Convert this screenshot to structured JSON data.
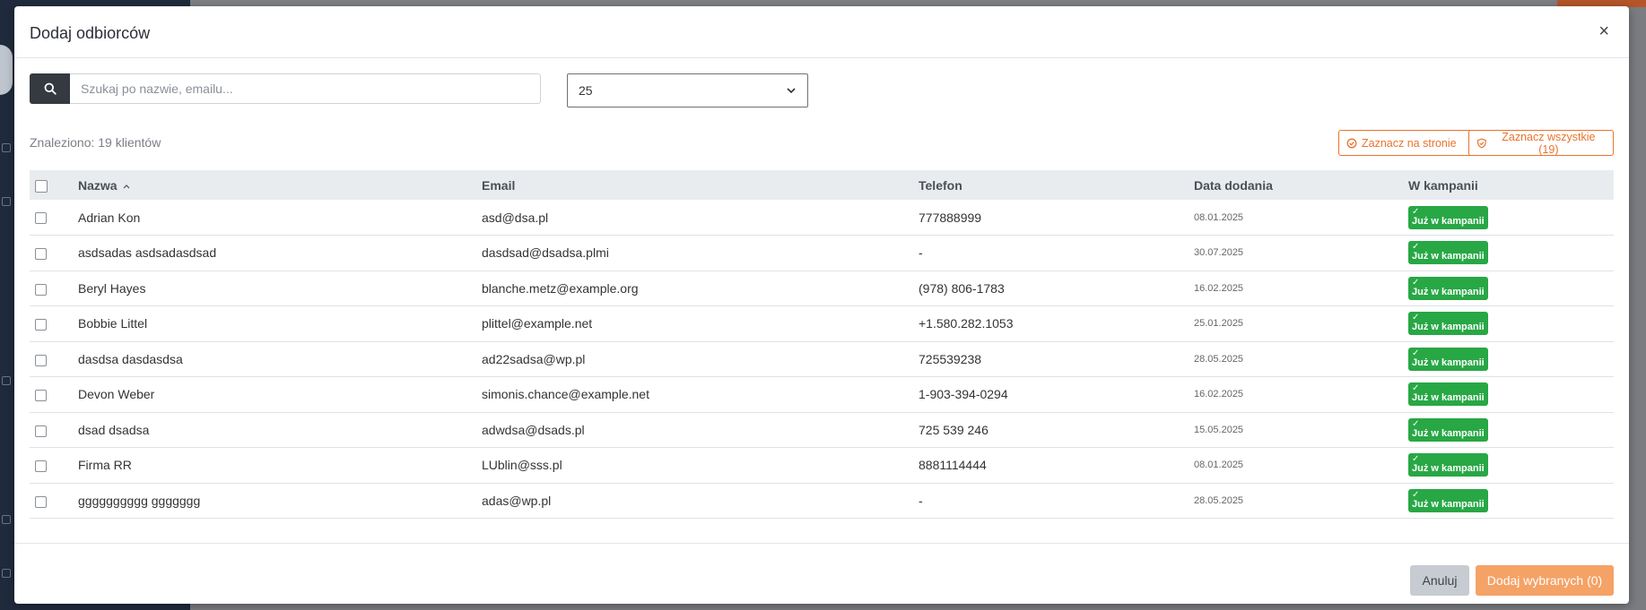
{
  "modal": {
    "title": "Dodaj odbiorców",
    "close": "×"
  },
  "search": {
    "placeholder": "Szukaj po nazwie, emailu...",
    "value": ""
  },
  "per_page": {
    "selected": "25"
  },
  "summary": {
    "found_text": "Znaleziono: 19 klientów",
    "select_page_label": "Zaznacz na stronie",
    "select_all_label": "Zaznacz wszystkie (19)"
  },
  "table": {
    "columns": {
      "name": "Nazwa",
      "email": "Email",
      "phone": "Telefon",
      "date": "Data dodania",
      "campaign": "W kampanii"
    },
    "sort_indicator": "^",
    "rows": [
      {
        "name": "Adrian Kon",
        "email": "asd@dsa.pl",
        "phone": "777888999",
        "date": "08.01.2025",
        "status": "Już w kampanii"
      },
      {
        "name": "asdsadas asdsadasdsad",
        "email": "dasdsad@dsadsa.plmi",
        "phone": "-",
        "date": "30.07.2025",
        "status": "Już w kampanii"
      },
      {
        "name": "Beryl Hayes",
        "email": "blanche.metz@example.org",
        "phone": "(978) 806-1783",
        "date": "16.02.2025",
        "status": "Już w kampanii"
      },
      {
        "name": "Bobbie Littel",
        "email": "plittel@example.net",
        "phone": "+1.580.282.1053",
        "date": "25.01.2025",
        "status": "Już w kampanii"
      },
      {
        "name": "dasdsa dasdasdsa",
        "email": "ad22sadsa@wp.pl",
        "phone": "725539238",
        "date": "28.05.2025",
        "status": "Już w kampanii"
      },
      {
        "name": "Devon Weber",
        "email": "simonis.chance@example.net",
        "phone": "1-903-394-0294",
        "date": "16.02.2025",
        "status": "Już w kampanii"
      },
      {
        "name": "dsad dsadsa",
        "email": "adwdsa@dsads.pl",
        "phone": "725 539 246",
        "date": "15.05.2025",
        "status": "Już w kampanii"
      },
      {
        "name": "Firma RR",
        "email": "LUblin@sss.pl",
        "phone": "8881114444",
        "date": "08.01.2025",
        "status": "Już w kampanii"
      },
      {
        "name": "gggggggggg ggggggg",
        "email": "adas@wp.pl",
        "phone": "-",
        "date": "28.05.2025",
        "status": "Już w kampanii"
      }
    ]
  },
  "footer": {
    "cancel_label": "Anuluj",
    "add_label": "Dodaj wybranych (0)"
  },
  "colors": {
    "accent": "#e8732e",
    "success": "#28a745",
    "dark": "#343a40"
  }
}
